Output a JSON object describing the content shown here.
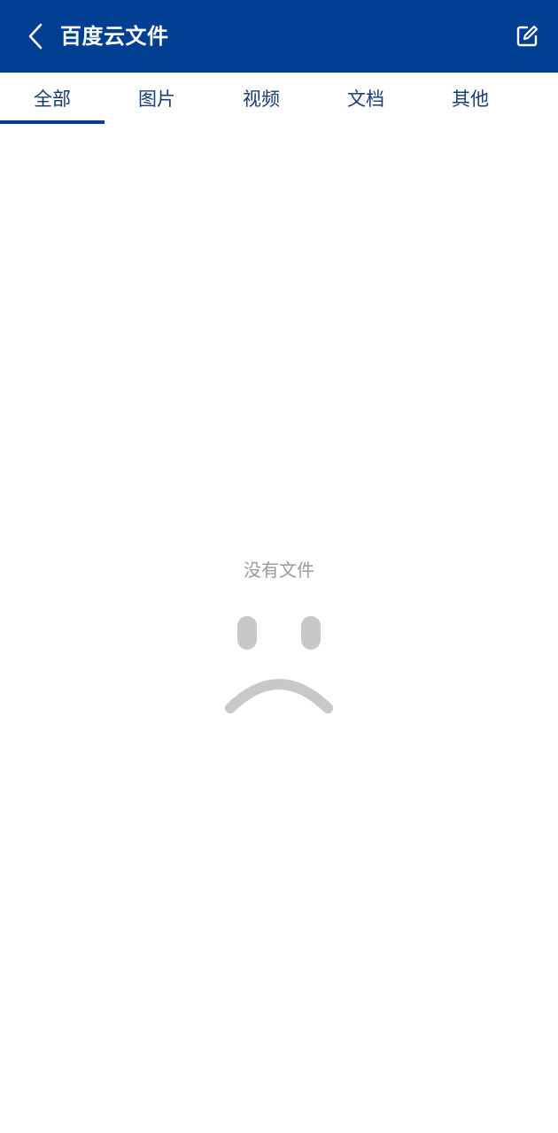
{
  "header": {
    "title": "百度云文件",
    "back_icon": "chevron-left-icon",
    "edit_icon": "edit-icon",
    "background_color": "#003f91"
  },
  "tabs": [
    {
      "label": "全部",
      "active": true
    },
    {
      "label": "图片",
      "active": false
    },
    {
      "label": "视频",
      "active": false
    },
    {
      "label": "文档",
      "active": false
    },
    {
      "label": "其他",
      "active": false
    }
  ],
  "empty_state": {
    "message": "没有文件",
    "icon": "sad-face-icon",
    "icon_color": "#c8c8c8"
  }
}
